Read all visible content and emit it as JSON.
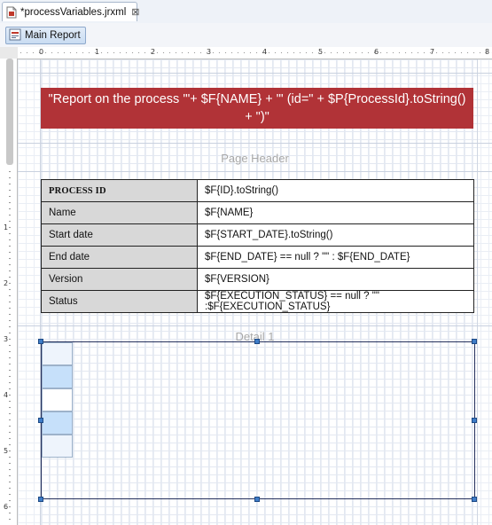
{
  "editor": {
    "tab_label": "*processVariables.jrxml",
    "tab_close_glyph": "⊠",
    "main_report_label": "Main Report"
  },
  "ruler": {
    "top_numbers": [
      "0",
      "1",
      "2",
      "3",
      "4",
      "5",
      "6",
      "7",
      "8"
    ],
    "left_numbers": [
      "1",
      "2",
      "3",
      "4",
      "5",
      "6"
    ]
  },
  "report": {
    "title_text": "\"Report on the process '\"+ $F{NAME} + \"' (id=\" + $P{ProcessId}.toString() + \")\"",
    "page_header_label": "Page Header",
    "detail_label": "Detail 1",
    "rows": [
      {
        "key": "PROCESS ID",
        "value": "$F{ID}.toString()"
      },
      {
        "key": "Name",
        "value": "$F{NAME}"
      },
      {
        "key": "Start date",
        "value": "$F{START_DATE}.toString()"
      },
      {
        "key": "End date",
        "value": "$F{END_DATE} == null ? \"\" : $F{END_DATE}"
      },
      {
        "key": "Version",
        "value": "$F{VERSION}"
      },
      {
        "key": "Status",
        "value": "$F{EXECUTION_STATUS} == null ? \"\" :$F{EXECUTION_STATUS}"
      }
    ]
  },
  "colors": {
    "title_band": "#b13337",
    "selection_handle": "#3e7cc7",
    "subreport_cell_fill": "#c6e0fa"
  }
}
